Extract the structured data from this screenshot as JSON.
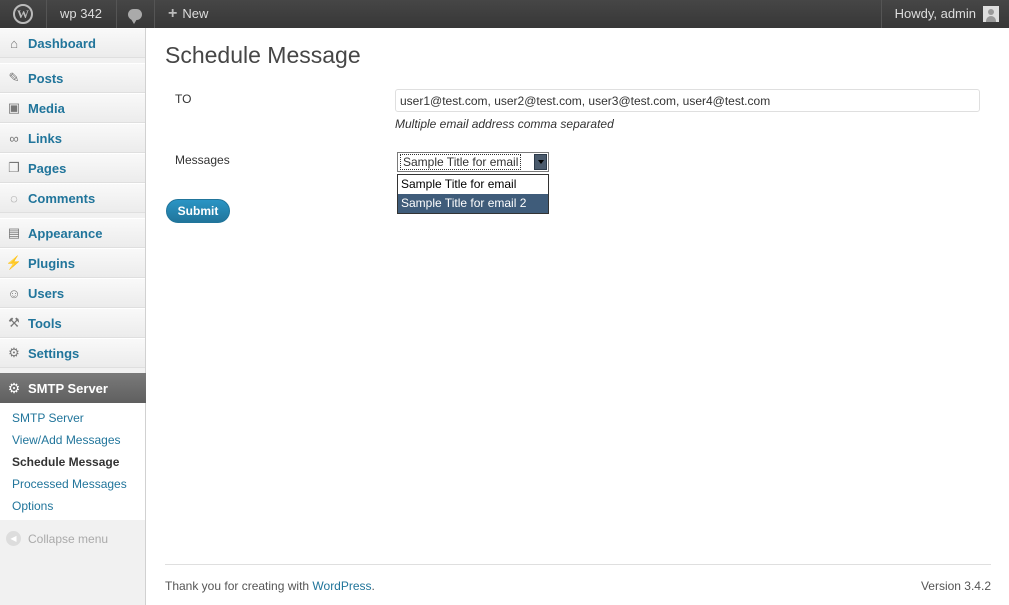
{
  "adminbar": {
    "site_name": "wp 342",
    "new_label": "New",
    "howdy": "Howdy, admin"
  },
  "menu": {
    "items": [
      {
        "label": "Dashboard",
        "icon": "house-icon"
      },
      {
        "label": "Posts",
        "icon": "pushpin-icon"
      },
      {
        "label": "Media",
        "icon": "media-icon"
      },
      {
        "label": "Links",
        "icon": "chain-link-icon"
      },
      {
        "label": "Pages",
        "icon": "pages-icon"
      },
      {
        "label": "Comments",
        "icon": "comment-bubble-icon"
      },
      {
        "label": "Appearance",
        "icon": "appearance-icon"
      },
      {
        "label": "Plugins",
        "icon": "plug-icon"
      },
      {
        "label": "Users",
        "icon": "users-icon"
      },
      {
        "label": "Tools",
        "icon": "tools-icon"
      },
      {
        "label": "Settings",
        "icon": "settings-icon"
      }
    ],
    "smtp": {
      "label": "SMTP Server",
      "submenu": [
        "SMTP Server",
        "View/Add Messages",
        "Schedule Message",
        "Processed Messages",
        "Options"
      ],
      "current": "Schedule Message"
    },
    "collapse": "Collapse menu"
  },
  "main": {
    "title": "Schedule Message",
    "to_label": "TO",
    "to_value": "user1@test.com, user2@test.com, user3@test.com, user4@test.com",
    "to_hint": "Multiple email address comma separated",
    "messages_label": "Messages",
    "selected": "Sample Title for email",
    "options": [
      "Sample Title for email",
      "Sample Title for email 2"
    ],
    "highlighted_option": "Sample Title for email 2",
    "submit": "Submit"
  },
  "footer": {
    "thanks_prefix": "Thank you for creating with ",
    "wordpress": "WordPress",
    "thanks_suffix": ".",
    "version": "Version 3.4.2"
  },
  "colors": {
    "link": "#21759b",
    "adminbar": "#464646",
    "menu_active": "#6a6a6a",
    "dropdown_highlight": "#3f5c7a"
  }
}
